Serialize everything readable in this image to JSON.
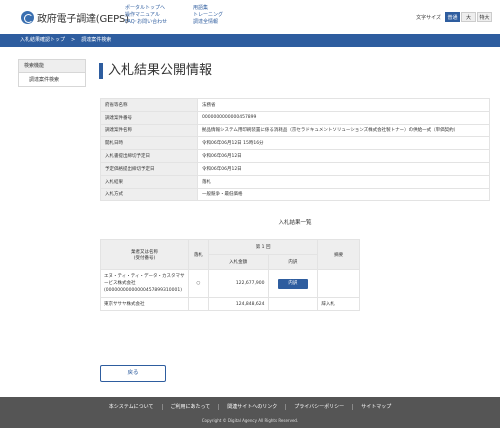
{
  "header": {
    "logo_text": "政府電子調達(GEPS)",
    "nav_col1": [
      "ポータルトップへ",
      "操作マニュアル",
      "FAQ･お問い合わせ"
    ],
    "nav_col2": [
      "用語集",
      "トレーニング",
      "調達全情報"
    ],
    "font_size_label": "文字サイズ",
    "font_sizes": [
      "普通",
      "大",
      "特大"
    ],
    "font_size_selected": "普通"
  },
  "breadcrumb": [
    "入札結果確認トップ",
    "調達案件検索"
  ],
  "sidebar": {
    "heading": "検索機能",
    "items": [
      "調達案件検索"
    ]
  },
  "main": {
    "title": "入札結果公開情報",
    "info_rows": [
      {
        "label": "府省等名称",
        "value": "法務省"
      },
      {
        "label": "調達案件番号",
        "value": "0000000000000457899"
      },
      {
        "label": "調達案件名称",
        "value": "拠品情報システム用印刷装置に係る消耗品（京セラドキュメントソリューションズ株式会社製トナー）の供給一式（単価契約）"
      },
      {
        "label": "開札日時",
        "value": "令和06年06月12日 15時16分"
      },
      {
        "label": "入札書提出締切予定日",
        "value": "令和06年06月12日"
      },
      {
        "label": "予定価格提出締切予定日",
        "value": "令和06年06月12日"
      },
      {
        "label": "入札結果",
        "value": "落札"
      },
      {
        "label": "入札方式",
        "value": "一般競争・最低価格"
      }
    ],
    "results_title": "入札結果一覧",
    "results_headers": {
      "company": "業者又は名称\n(受付番号)",
      "award": "落札",
      "round": "第 1 回",
      "amount": "入札金額",
      "detail": "内訳",
      "remarks": "摘要"
    },
    "results_rows": [
      {
        "company": "エヌ・ティ・ティ・データ・カスタマサービス株式会社",
        "receipt": "(00000000000000457899310001)",
        "award": "○",
        "amount": "122,677,900",
        "detail_button": "内訳",
        "remarks": ""
      },
      {
        "company": "東京ササヤ株式会社",
        "receipt": "",
        "award": "",
        "amount": "124,848,624",
        "detail_button": "",
        "remarks": "辞入札"
      }
    ],
    "back_button": "戻る"
  },
  "footer": {
    "links": [
      "本システムについて",
      "ご利用にあたって",
      "関連サイトへのリンク",
      "プライバシーポリシー",
      "サイトマップ"
    ],
    "copyright": "Copyright © Digital Agency All Rights Reserved."
  },
  "colors": {
    "brand_blue": "#2e5d9f",
    "footer_bg": "#555555",
    "table_header_bg": "#eeeeee"
  }
}
